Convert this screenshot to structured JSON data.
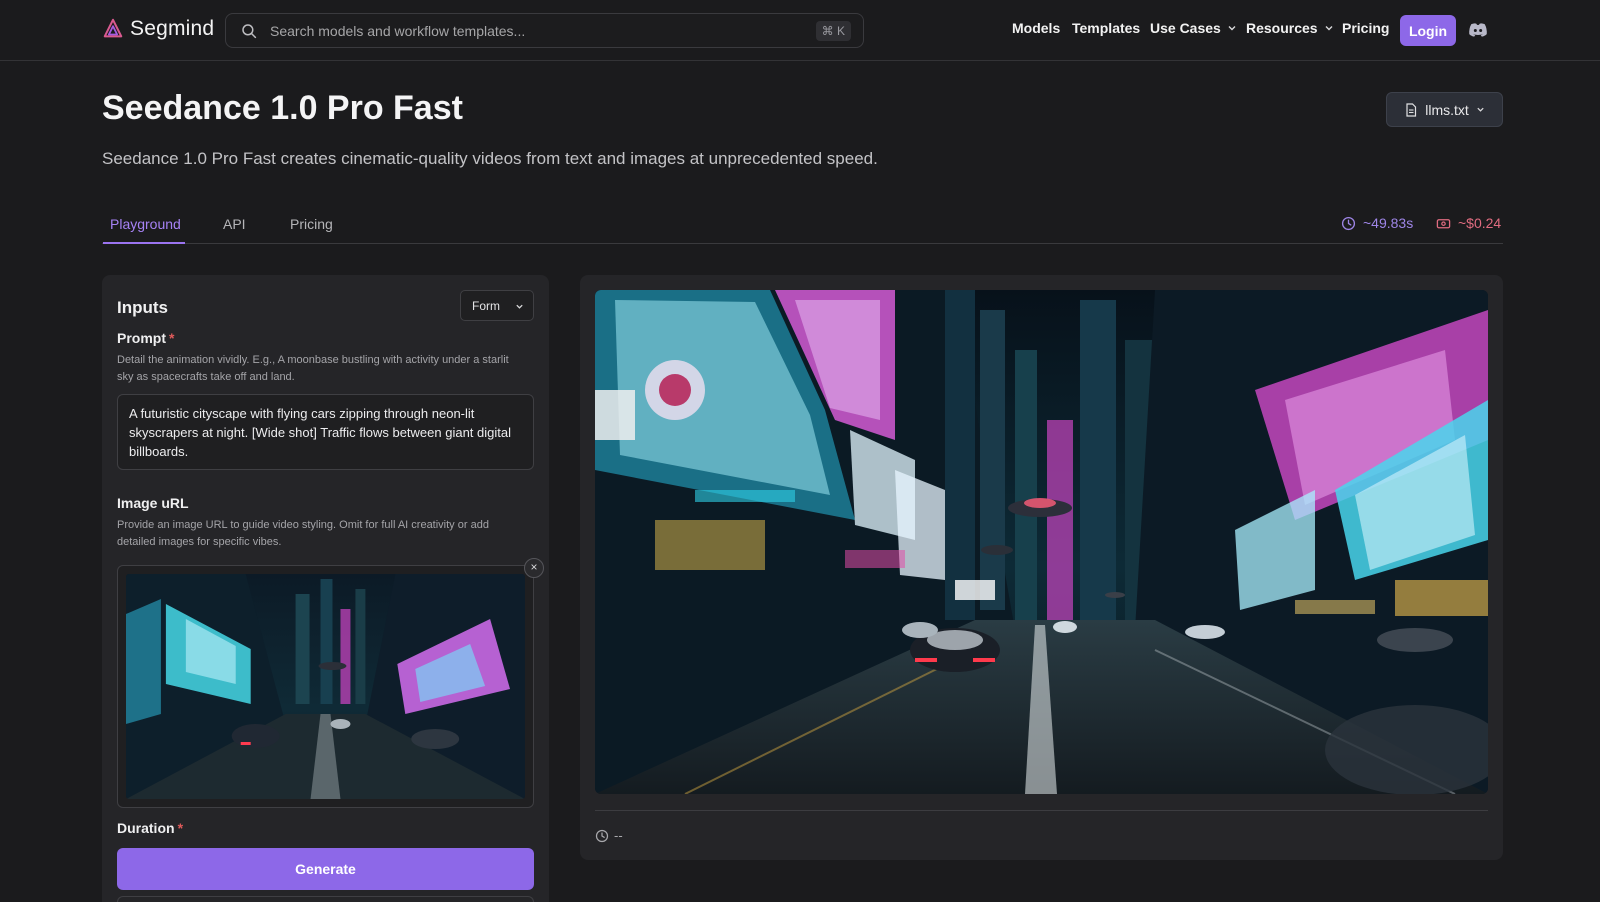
{
  "header": {
    "brand": "Segmind",
    "search_placeholder": "Search models and workflow templates...",
    "search_shortcut": "⌘ K",
    "nav": {
      "models": "Models",
      "templates": "Templates",
      "use_cases": "Use Cases",
      "resources": "Resources",
      "pricing": "Pricing"
    },
    "login": "Login",
    "icons": [
      "segmind-logo-icon",
      "search-icon",
      "chevron-down-icon",
      "discord-icon"
    ]
  },
  "page": {
    "title": "Seedance 1.0 Pro Fast",
    "subtitle": "Seedance 1.0 Pro Fast creates cinematic-quality videos from text and images at unprecedented speed.",
    "llms_button": "llms.txt"
  },
  "tabs": [
    {
      "label": "Playground",
      "active": true
    },
    {
      "label": "API",
      "active": false
    },
    {
      "label": "Pricing",
      "active": false
    }
  ],
  "stats": {
    "time": "~49.83s",
    "cost": "~$0.24"
  },
  "inputs": {
    "title": "Inputs",
    "mode": "Form",
    "prompt": {
      "label": "Prompt",
      "required_mark": "*",
      "help": "Detail the animation vividly. E.g., A moonbase bustling with activity under a starlit sky as spacecrafts take off and land.",
      "value": "A futuristic cityscape with flying cars zipping through neon-lit skyscrapers at night. [Wide shot] Traffic flows between giant digital billboards."
    },
    "image_url": {
      "label": "Image uRL",
      "help": "Provide an image URL to guide video styling. Omit for full AI creativity or add detailed images for specific vibes.",
      "remove": "×"
    },
    "duration": {
      "label": "Duration",
      "required_mark": "*"
    },
    "generate": "Generate"
  },
  "output": {
    "time_value": "--"
  },
  "colors": {
    "accent": "#8d68e8",
    "tab_active": "#a682f5",
    "stat_time": "#9f86e8",
    "stat_cost": "#e06c80",
    "background": "#1b1b1d",
    "panel": "#252528"
  }
}
